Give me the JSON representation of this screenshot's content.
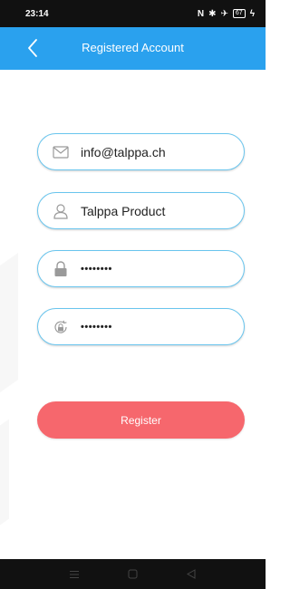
{
  "status_bar": {
    "time": "23:14",
    "signal_text": "ℕ",
    "battery": "67"
  },
  "header": {
    "title": "Registered Account",
    "back_icon": "chevron-left-icon"
  },
  "form": {
    "email": {
      "value": "info@talppa.ch",
      "icon": "envelope-icon"
    },
    "name": {
      "value": "Talppa Product",
      "icon": "user-icon"
    },
    "password": {
      "value": "••••••••",
      "icon": "lock-icon"
    },
    "confirm_password": {
      "value": "••••••••",
      "icon": "lock-refresh-icon"
    }
  },
  "register_button": {
    "label": "Register",
    "color": "#f6676d"
  },
  "colors": {
    "header": "#2aa1ee",
    "field_border": "#69c5ee",
    "status_bar": "#111111"
  }
}
